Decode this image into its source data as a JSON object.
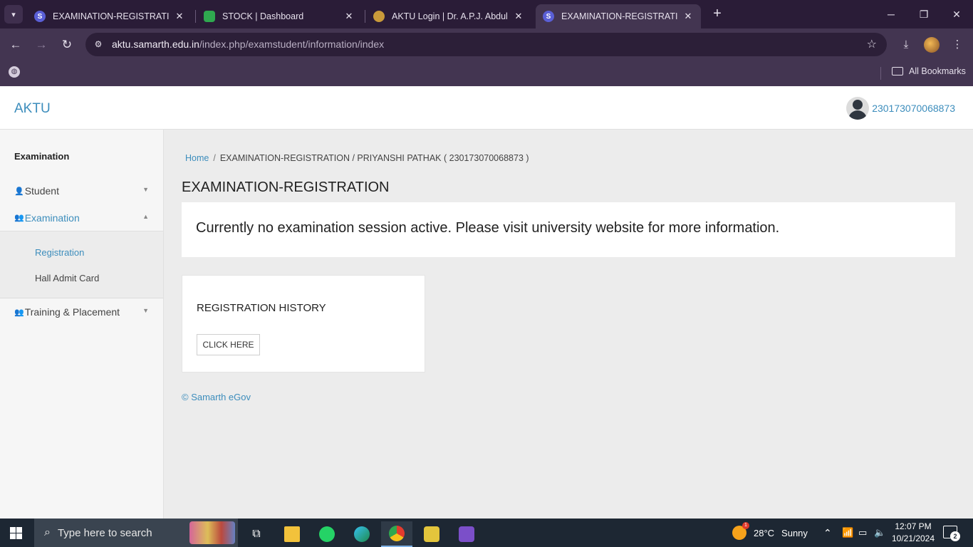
{
  "browser": {
    "tabs": [
      {
        "title": "EXAMINATION-REGISTRATION",
        "favicon": "S",
        "favicon_color": "#5a5fd6",
        "active": false
      },
      {
        "title": "STOCK | Dashboard",
        "favicon": "",
        "favicon_color": "#2fa84f",
        "active": false
      },
      {
        "title": "AKTU Login | Dr. A.P.J. Abdul Ka",
        "favicon": "",
        "favicon_color": "#c99a3a",
        "active": false
      },
      {
        "title": "EXAMINATION-REGISTRATION",
        "favicon": "S",
        "favicon_color": "#5a5fd6",
        "active": true
      }
    ],
    "url_host": "aktu.samarth.edu.in",
    "url_path": "/index.php/examstudent/information/index",
    "bookmarks_label": "All Bookmarks"
  },
  "header": {
    "brand": "AKTU",
    "user_id": "230173070068873"
  },
  "sidebar": {
    "heading": "Examination",
    "items": [
      {
        "label": "Student",
        "icon": "user-icon"
      },
      {
        "label": "Examination",
        "icon": "users-icon"
      },
      {
        "label": "Training & Placement",
        "icon": "users-icon"
      }
    ],
    "sub_items": [
      {
        "label": "Registration"
      },
      {
        "label": "Hall Admit Card"
      }
    ]
  },
  "main": {
    "breadcrumb": {
      "home": "Home",
      "separator": "/",
      "current": "EXAMINATION-REGISTRATION / PRIYANSHI PATHAK ( 230173070068873 )"
    },
    "page_title": "EXAMINATION-REGISTRATION",
    "alert_message": "Currently no examination session active. Please visit university website for more information.",
    "history_card": {
      "title": "REGISTRATION HISTORY",
      "button_label": "CLICK HERE"
    },
    "footer": "© Samarth eGov"
  },
  "taskbar": {
    "search_placeholder": "Type here to search",
    "weather_temp": "28°C",
    "weather_desc": "Sunny",
    "weather_badge": "1",
    "time": "12:07 PM",
    "date": "10/21/2024",
    "notification_count": "2"
  },
  "colors": {
    "accent": "#3c8dbc",
    "browser_frame": "#2a1c37",
    "browser_toolbar": "#433551",
    "taskbar": "#1d2733"
  }
}
